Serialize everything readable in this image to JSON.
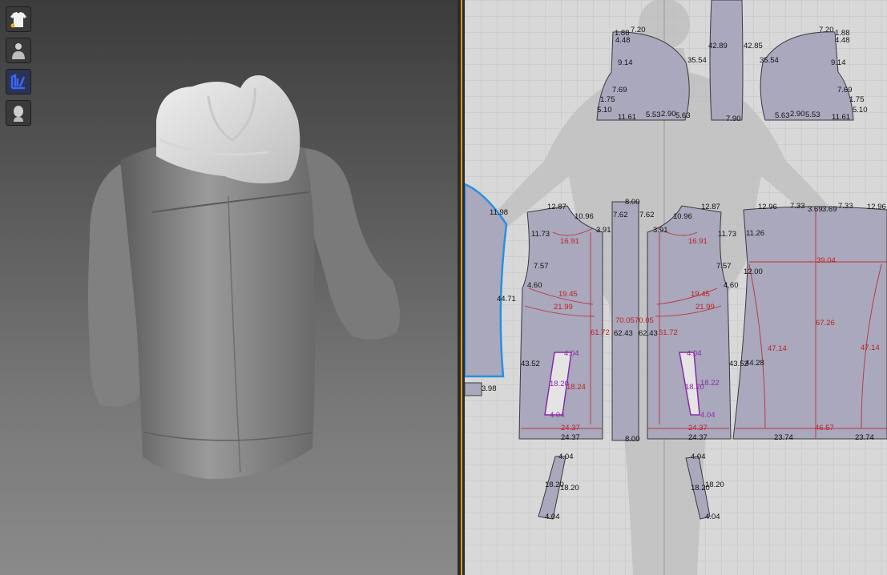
{
  "toolbar": {
    "buttons": [
      {
        "icon": "garment-shirt-icon"
      },
      {
        "icon": "avatar-body-icon"
      },
      {
        "icon": "pattern-edit-icon"
      },
      {
        "icon": "avatar-head-icon"
      }
    ]
  },
  "colors": {
    "accent_divider": "#d89a1a",
    "pattern_fill": "#a9a8bd",
    "selected_outline": "#2a8fe0",
    "measure_red": "#c21f1f"
  },
  "patterns": {
    "sleeve_left": {
      "m1": "1.88",
      "m2": "4.48",
      "m3": "7.20",
      "m4": "9.14",
      "m5": "7.69",
      "m6": "1.75",
      "m7": "5.10",
      "m8": "11.61",
      "m9": "5.53",
      "m10": "2.90",
      "m11": "5.63",
      "m12": "35.54"
    },
    "hood_strip": {
      "m1": "42.89",
      "m2": "42.85",
      "m3": "7.90"
    },
    "sleeve_right": {
      "m1": "7.20",
      "m2": "1.88",
      "m3": "4.48",
      "m4": "35.54",
      "m5": "9.14",
      "m6": "7.69",
      "m7": "1.75",
      "m8": "5.10",
      "m9": "5.63",
      "m10": "2.90",
      "m11": "5.53",
      "m12": "11.61"
    },
    "left_edge": {
      "m1": "11.98",
      "m2": "44.71",
      "m3": "3.98"
    },
    "front_left": {
      "m1": "12.87",
      "m2": "10.96",
      "m3": "11.73",
      "m4": "3.91",
      "m5": "16.91",
      "m6": "7.57",
      "m7": "4.60",
      "m8": "19.45",
      "m9": "21.99",
      "m10": "61.72",
      "m11": "43.52",
      "m12": "4.04",
      "m13": "18.20",
      "m14": "18.24",
      "m15": "4.04",
      "m16": "24.37",
      "m17": "24.37"
    },
    "zip_strip": {
      "m1": "8.00",
      "m2": "7.62",
      "m3": "7.62",
      "m4": "70.05",
      "m5": "70.05",
      "m6": "62.43",
      "m7": "62.43",
      "m8": "8.00"
    },
    "front_right": {
      "m1": "10.96",
      "m2": "12.87",
      "m3": "3.91",
      "m4": "11.73",
      "m5": "16.91",
      "m6": "7.57",
      "m7": "4.60",
      "m8": "19.45",
      "m9": "21.99",
      "m10": "61.72",
      "m11": "43.52",
      "m12": "4.04",
      "m13": "18.20",
      "m14": "18.22",
      "m15": "4.04",
      "m16": "24.37",
      "m17": "24.37"
    },
    "back": {
      "m1": "12.96",
      "m2": "7.33",
      "m3": "3.69",
      "m4": "3.69",
      "m5": "7.33",
      "m6": "12.96",
      "m7": "11.26",
      "m8": "39.04",
      "m9": "12.00",
      "m10": "67.26",
      "m11": "47.14",
      "m12": "47.14",
      "m13": "44.28",
      "m14": "46.57",
      "m15": "23.74",
      "m16": "23.74"
    },
    "pocket_left": {
      "m1": "4.04",
      "m2": "18.20",
      "m3": "18.20",
      "m4": "4.04"
    },
    "pocket_right": {
      "m1": "4.04",
      "m2": "18.20",
      "m3": "18.20",
      "m4": "4.04"
    }
  }
}
